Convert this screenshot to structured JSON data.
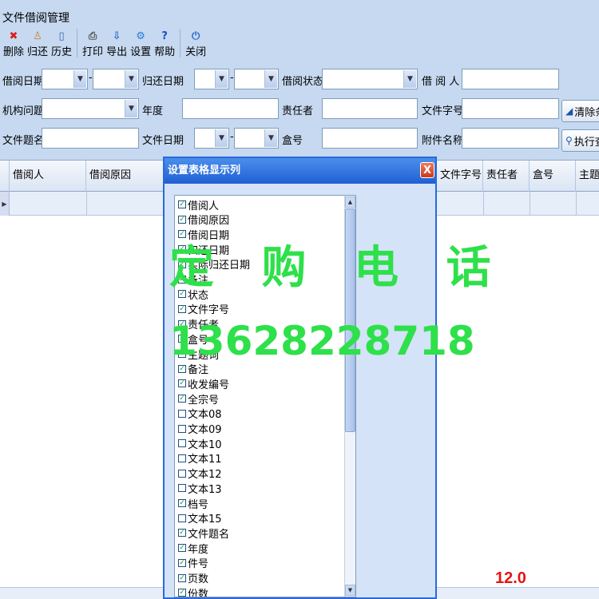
{
  "window": {
    "title": "文件借阅管理"
  },
  "toolbar": {
    "buttons": [
      {
        "label": "删除",
        "icon": "delete-icon",
        "glyph": "✖",
        "color": "#d92020"
      },
      {
        "label": "归还",
        "icon": "return-icon",
        "glyph": "♙",
        "color": "#c8872a"
      },
      {
        "label": "历史",
        "icon": "history-icon",
        "glyph": "▯",
        "color": "#3a66b0"
      },
      {
        "label": "打印",
        "icon": "print-icon",
        "glyph": "⎙",
        "color": "#555555"
      },
      {
        "label": "导出",
        "icon": "export-icon",
        "glyph": "⇩",
        "color": "#2a6acb"
      },
      {
        "label": "设置",
        "icon": "settings-icon",
        "glyph": "⚙",
        "color": "#2a7ad8"
      },
      {
        "label": "帮助",
        "icon": "help-icon",
        "glyph": "?",
        "color": "#1a4fc0"
      },
      {
        "label": "关闭",
        "icon": "close-icon",
        "glyph": "⏻",
        "color": "#2a6acb"
      }
    ]
  },
  "filters": {
    "borrow_date": "借阅日期",
    "return_date": "归还日期",
    "borrow_status": "借阅状态",
    "borrower": "借 阅 人",
    "org_issue": "机构问题",
    "year": "年度",
    "responsible": "责任者",
    "doc_number": "文件字号",
    "doc_title": "文件题名",
    "doc_date": "文件日期",
    "box_number": "盒号",
    "attachment": "附件名称",
    "dash": "-"
  },
  "actions": {
    "clear": "清除条件",
    "execute": "执行查询"
  },
  "grid": {
    "columns": [
      "借阅人",
      "借阅原因",
      "文件字号",
      "责任者",
      "盒号",
      "主题词"
    ]
  },
  "dialog": {
    "title": "设置表格显示列",
    "close_glyph": "X",
    "items": [
      {
        "label": "借阅人",
        "checked": true
      },
      {
        "label": "借阅原因",
        "checked": true
      },
      {
        "label": "借阅日期",
        "checked": true
      },
      {
        "label": "归还日期",
        "checked": true
      },
      {
        "label": "实际归还日期",
        "checked": true
      },
      {
        "label": "备注",
        "checked": true
      },
      {
        "label": "状态",
        "checked": true
      },
      {
        "label": "文件字号",
        "checked": true
      },
      {
        "label": "责任者",
        "checked": true
      },
      {
        "label": "盒号",
        "checked": true
      },
      {
        "label": "主题词",
        "checked": true
      },
      {
        "label": "备注",
        "checked": true
      },
      {
        "label": "收发编号",
        "checked": true
      },
      {
        "label": "全宗号",
        "checked": true
      },
      {
        "label": "文本08",
        "checked": false
      },
      {
        "label": "文本09",
        "checked": false
      },
      {
        "label": "文本10",
        "checked": false
      },
      {
        "label": "文本11",
        "checked": false
      },
      {
        "label": "文本12",
        "checked": false
      },
      {
        "label": "文本13",
        "checked": false
      },
      {
        "label": "档号",
        "checked": true
      },
      {
        "label": "文本15",
        "checked": false
      },
      {
        "label": "文件题名",
        "checked": true
      },
      {
        "label": "年度",
        "checked": true
      },
      {
        "label": "件号",
        "checked": true
      },
      {
        "label": "页数",
        "checked": true
      },
      {
        "label": "份数",
        "checked": true
      }
    ]
  },
  "watermark": {
    "title": "定 购 电 话",
    "phone": "13628228718"
  },
  "version": "12.0"
}
